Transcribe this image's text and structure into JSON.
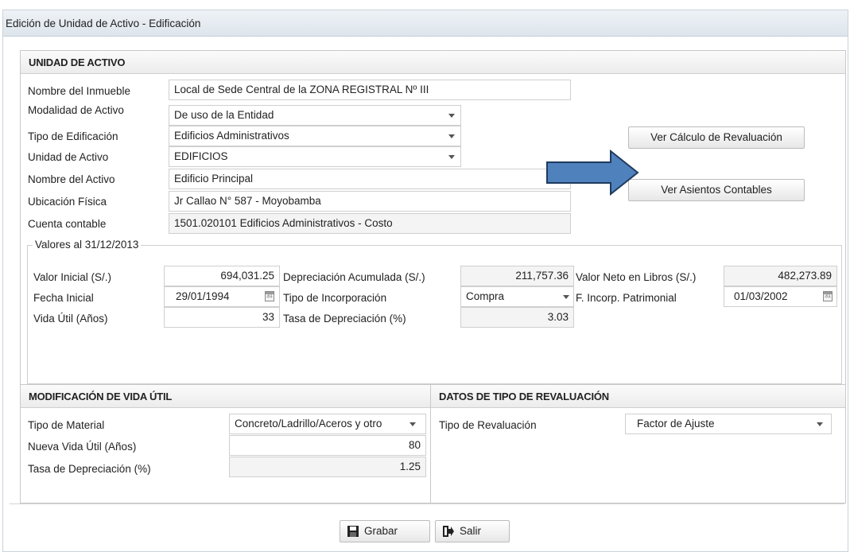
{
  "window": {
    "title": "Edición de Unidad de Activo - Edificación"
  },
  "unidad": {
    "header": "UNIDAD DE ACTIVO",
    "fields": {
      "nombre_inmueble": {
        "label": "Nombre del Inmueble",
        "value": "Local de Sede Central de la ZONA REGISTRAL Nº III"
      },
      "modalidad": {
        "label": "Modalidad de Activo",
        "value": "De uso de la Entidad"
      },
      "tipo_edificacion": {
        "label": "Tipo de Edificación",
        "value": "Edificios Administrativos"
      },
      "unidad_activo": {
        "label": "Unidad de Activo",
        "value": "EDIFICIOS"
      },
      "nombre_activo": {
        "label": "Nombre del Activo",
        "value": "Edificio Principal"
      },
      "ubicacion": {
        "label": "Ubicación Física",
        "value": "Jr Callao N° 587 - Moyobamba"
      },
      "cuenta": {
        "label": "Cuenta contable",
        "value": "1501.020101 Edificios Administrativos - Costo"
      }
    },
    "buttons": {
      "ver_calculo": "Ver Cálculo de Revaluación",
      "ver_asientos": "Ver Asientos Contables"
    },
    "valores": {
      "legend": "Valores al 31/12/2013",
      "valor_inicial": {
        "label": "Valor Inicial (S/.)",
        "value": "694,031.25"
      },
      "depreciacion_acumulada": {
        "label": "Depreciación Acumulada (S/.)",
        "value": "211,757.36"
      },
      "valor_neto": {
        "label": "Valor Neto en Libros (S/.)",
        "value": "482,273.89"
      },
      "fecha_inicial": {
        "label": "Fecha Inicial",
        "value": "29/01/1994"
      },
      "tipo_incorporacion": {
        "label": "Tipo de Incorporación",
        "value": "Compra"
      },
      "f_incorp": {
        "label": "F. Incorp. Patrimonial",
        "value": "01/03/2002"
      },
      "vida_util": {
        "label": "Vida Útil (Años)",
        "value": "33"
      },
      "tasa_depreciacion": {
        "label": "Tasa de Depreciación (%)",
        "value": "3.03"
      }
    }
  },
  "modificacion": {
    "header": "MODIFICACIÓN DE VIDA ÚTIL",
    "tipo_material": {
      "label": "Tipo de Material",
      "value": "Concreto/Ladrillo/Aceros y otro"
    },
    "nueva_vida": {
      "label": "Nueva Vida Útil (Años)",
      "value": "80"
    },
    "tasa": {
      "label": "Tasa de Depreciación (%)",
      "value": "1.25"
    }
  },
  "revaluacion": {
    "header": "DATOS DE TIPO DE REVALUACIÓN",
    "tipo": {
      "label": "Tipo de Revaluación",
      "value": "Factor de Ajuste"
    }
  },
  "footer": {
    "grabar": "Grabar",
    "salir": "Salir"
  },
  "colors": {
    "arrow_fill": "#4f81bd",
    "arrow_stroke": "#1f3b5c",
    "titlebar": "#e4eaf0"
  },
  "icons": [
    "calendar-icon",
    "chevron-down-icon",
    "save-icon",
    "exit-icon",
    "arrow-right-icon"
  ]
}
